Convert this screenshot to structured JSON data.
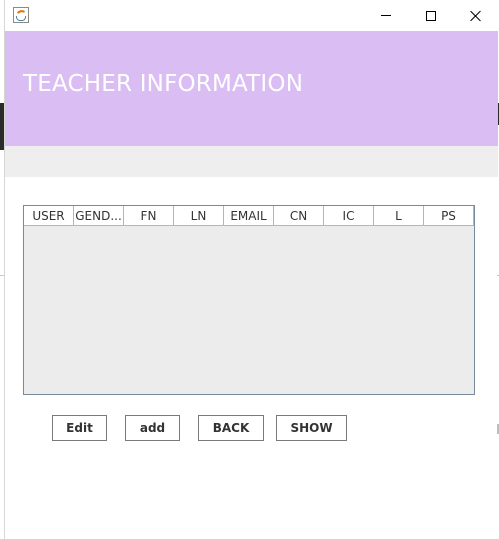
{
  "window": {
    "controls": {
      "minimize_icon": "minimize-icon",
      "maximize_icon": "maximize-icon",
      "close_icon": "close-icon"
    },
    "app_icon": "java-cup-icon"
  },
  "header": {
    "title": "TEACHER INFORMATION",
    "background": "#dabdf3",
    "text_color": "#ffffff"
  },
  "table": {
    "columns": [
      "USER",
      "GEND...",
      "FN",
      "LN",
      "EMAIL",
      "CN",
      "IC",
      "L",
      "PS"
    ],
    "rows": []
  },
  "actions": {
    "edit_label": "Edit",
    "add_label": "add",
    "back_label": "BACK",
    "show_label": "SHOW"
  }
}
